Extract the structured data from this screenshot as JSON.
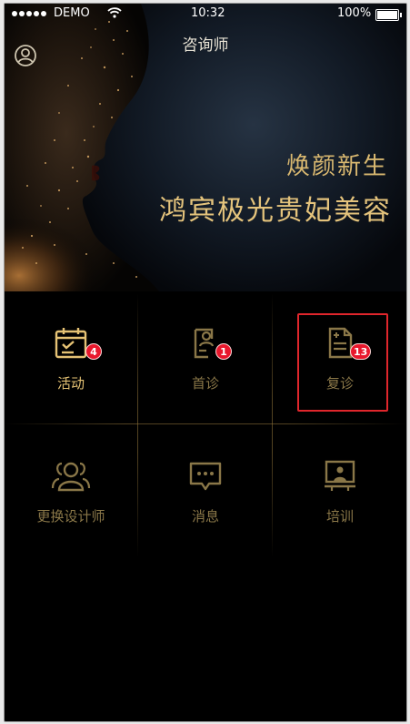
{
  "status_bar": {
    "carrier": "DEMO",
    "time": "10:32",
    "battery": "100%"
  },
  "nav": {
    "title": "咨询师"
  },
  "banner": {
    "slogan_line1": "焕颜新生",
    "slogan_line2": "鸿宾极光贵妃美容"
  },
  "menu": {
    "items": [
      {
        "label": "活动",
        "badge": "4"
      },
      {
        "label": "首诊",
        "badge": "1"
      },
      {
        "label": "复诊",
        "badge": "13"
      },
      {
        "label": "更换设计师"
      },
      {
        "label": "消息"
      },
      {
        "label": "培训"
      }
    ]
  },
  "colors": {
    "accent_gold": "#e5c274",
    "muted_gold": "#8a7748",
    "badge_red": "#e8172c",
    "highlight_red": "#e0262c"
  }
}
